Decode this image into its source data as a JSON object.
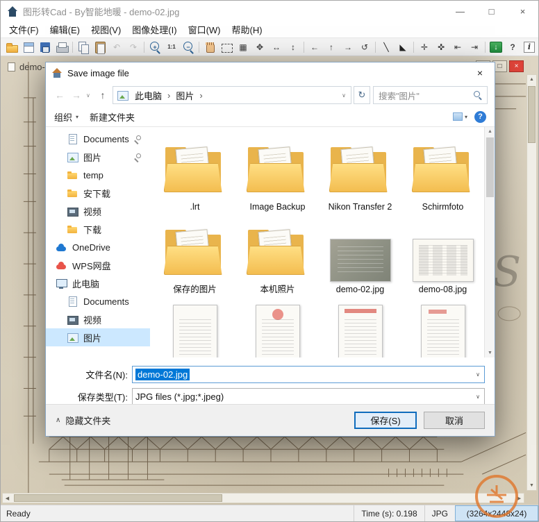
{
  "app": {
    "title": "图形转Cad - By智能地暖 - demo-02.jpg",
    "menu": [
      "文件(F)",
      "编辑(E)",
      "视图(V)",
      "图像处理(I)",
      "窗口(W)",
      "帮助(H)"
    ],
    "toolbar": [
      {
        "name": "open"
      },
      {
        "name": "new-window"
      },
      {
        "name": "save"
      },
      {
        "name": "print"
      },
      {
        "sep": true
      },
      {
        "name": "copy"
      },
      {
        "name": "paste"
      },
      {
        "name": "undo",
        "glyph": "↶",
        "disabled": true
      },
      {
        "name": "redo",
        "glyph": "↷",
        "disabled": true
      },
      {
        "sep": true
      },
      {
        "name": "zoom-in",
        "glyph": "+"
      },
      {
        "name": "zoom-actual",
        "glyph": "1:1"
      },
      {
        "name": "zoom-out",
        "glyph": "−"
      },
      {
        "sep": true
      },
      {
        "name": "pan"
      },
      {
        "name": "select-region"
      },
      {
        "name": "grid",
        "glyph": "▦"
      },
      {
        "name": "move",
        "glyph": "✥"
      },
      {
        "name": "stretch-h",
        "glyph": "↔"
      },
      {
        "name": "stretch-v",
        "glyph": "↕"
      },
      {
        "sep": true
      },
      {
        "name": "arrow-left",
        "glyph": "←"
      },
      {
        "name": "arrow-up",
        "glyph": "↑"
      },
      {
        "name": "arrow-right",
        "glyph": "→"
      },
      {
        "name": "rotate",
        "glyph": "↺"
      },
      {
        "sep": true
      },
      {
        "name": "draw-line",
        "glyph": "╲"
      },
      {
        "name": "fill-triangle",
        "glyph": "◣"
      },
      {
        "sep": true
      },
      {
        "name": "crosshair-a",
        "glyph": "✛"
      },
      {
        "name": "crosshair-b",
        "glyph": "✜"
      },
      {
        "name": "first-point",
        "glyph": "⇤"
      },
      {
        "name": "last-point",
        "glyph": "⇥"
      },
      {
        "sep": true
      },
      {
        "name": "export",
        "glyph": "↓"
      },
      {
        "name": "help",
        "glyph": "?"
      },
      {
        "name": "info",
        "glyph": "i"
      },
      {
        "sep": true
      },
      {
        "name": "tools",
        "glyph": "✄"
      }
    ]
  },
  "child_window": {
    "title": "demo-02..."
  },
  "drawing": {
    "watermark_letter": "S"
  },
  "dialog": {
    "title": "Save image file",
    "nav": {
      "crumbs": [
        "此电脑",
        "图片"
      ],
      "search_placeholder": "搜索\"图片\""
    },
    "commands": {
      "organize": "组织",
      "new_folder": "新建文件夹"
    },
    "sidebar": [
      {
        "label": "Documents",
        "icon": "doc",
        "level": 2,
        "pinned": true
      },
      {
        "label": "图片",
        "icon": "pic",
        "level": 2,
        "pinned": true
      },
      {
        "label": "temp",
        "icon": "folder",
        "level": 2
      },
      {
        "label": "安下载",
        "icon": "folder",
        "level": 2
      },
      {
        "label": "视频",
        "icon": "video",
        "level": 2
      },
      {
        "label": "下载",
        "icon": "folder",
        "level": 2
      },
      {
        "label": "OneDrive",
        "icon": "cloud",
        "level": 1
      },
      {
        "label": "WPS网盘",
        "icon": "wps",
        "level": 1
      },
      {
        "label": "此电脑",
        "icon": "pc",
        "level": 1
      },
      {
        "label": "Documents",
        "icon": "doc",
        "level": 2
      },
      {
        "label": "视频",
        "icon": "video",
        "level": 2
      },
      {
        "label": "图片",
        "icon": "pic",
        "level": 2,
        "selected": true
      }
    ],
    "files": [
      {
        "label": ".lrt",
        "kind": "folder"
      },
      {
        "label": "Image Backup",
        "kind": "folder"
      },
      {
        "label": "Nikon Transfer 2",
        "kind": "folder"
      },
      {
        "label": "Schirmfoto",
        "kind": "folder"
      },
      {
        "label": "保存的图片",
        "kind": "folder"
      },
      {
        "label": "本机照片",
        "kind": "folder"
      },
      {
        "label": "demo-02.jpg",
        "kind": "photo-gray"
      },
      {
        "label": "demo-08.jpg",
        "kind": "photo-doc"
      },
      {
        "label": "",
        "kind": "partial-1"
      },
      {
        "label": "",
        "kind": "partial-2"
      },
      {
        "label": "",
        "kind": "partial-3"
      },
      {
        "label": "",
        "kind": "partial-4"
      }
    ],
    "filename": {
      "label": "文件名(N):",
      "value": "demo-02.jpg"
    },
    "filetype": {
      "label": "保存类型(T):",
      "value": "JPG files (*.jpg;*.jpeg)"
    },
    "hide_folders": "隐藏文件夹",
    "buttons": {
      "save": "保存(S)",
      "cancel": "取消"
    }
  },
  "statusbar": {
    "ready": "Ready",
    "time": "Time (s): 0.198",
    "format": "JPG",
    "dimensions": "(3264x2448x24)"
  },
  "icons": {
    "minimize": "—",
    "maximize": "□",
    "restore": "□",
    "close": "×",
    "back": "←",
    "forward": "→",
    "up": "↑",
    "caret_down": "∨",
    "dropdown": "▾",
    "refresh": "↻",
    "chevron": "›",
    "help": "?",
    "collapse": "∧",
    "scroll_up": "▲",
    "scroll_down": "▼",
    "scroll_left": "◀",
    "scroll_right": "▶"
  }
}
